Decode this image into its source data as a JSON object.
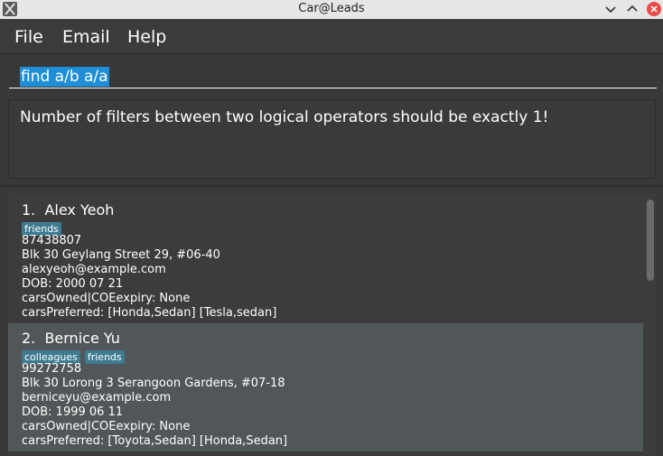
{
  "window": {
    "title": "Car@Leads"
  },
  "menu": {
    "items": [
      {
        "label": "File"
      },
      {
        "label": "Email"
      },
      {
        "label": "Help"
      }
    ]
  },
  "command": {
    "value": "find a/b a/a"
  },
  "result": {
    "message": "Number of filters between two logical operators should be exactly 1!"
  },
  "persons": [
    {
      "index": "1.",
      "name": "Alex Yeoh",
      "tags": [
        "friends"
      ],
      "phone": "87438807",
      "address": "Blk 30 Geylang Street 29, #06-40",
      "email": "alexyeoh@example.com",
      "dob": "DOB: 2000 07 21",
      "cars_owned": "carsOwned|COEexpiry: None",
      "cars_preferred": "carsPreferred: [Honda,Sedan] [Tesla,sedan]"
    },
    {
      "index": "2.",
      "name": "Bernice Yu",
      "tags": [
        "colleagues",
        "friends"
      ],
      "phone": "99272758",
      "address": "Blk 30 Lorong 3 Serangoon Gardens, #07-18",
      "email": "berniceyu@example.com",
      "dob": "DOB: 1999 06 11",
      "cars_owned": "carsOwned|COEexpiry: None",
      "cars_preferred": "carsPreferred: [Toyota,Sedan] [Honda,Sedan]"
    }
  ],
  "icons": {
    "app": "app-x-icon",
    "minimize": "chevron-down-icon",
    "maximize": "chevron-up-icon",
    "close": "close-icon"
  },
  "colors": {
    "background": "#383838",
    "selection": "#1e8fd6",
    "tag": "#3e7b91",
    "selected_card": "#515758",
    "close_button": "#e94b4b"
  }
}
